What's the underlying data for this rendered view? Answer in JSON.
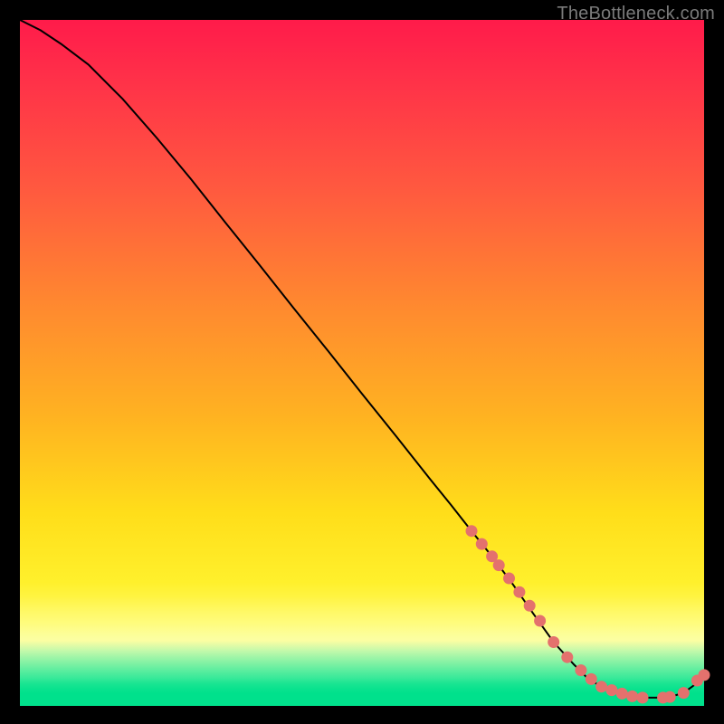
{
  "watermark": "TheBottleneck.com",
  "colors": {
    "dot": "#e4716d",
    "line": "#000000",
    "bg": "#000000"
  },
  "chart_data": {
    "type": "line",
    "title": "",
    "xlabel": "",
    "ylabel": "",
    "xlim": [
      0,
      100
    ],
    "ylim": [
      0,
      100
    ],
    "grid": false,
    "legend": false,
    "series": [
      {
        "name": "curve",
        "x": [
          0,
          3,
          6,
          10,
          15,
          20,
          25,
          30,
          35,
          40,
          45,
          50,
          55,
          60,
          63,
          66,
          69,
          72,
          75,
          78,
          81,
          83,
          85,
          87,
          89,
          91,
          93,
          95,
          97,
          98.5,
          100
        ],
        "y": [
          100,
          98.5,
          96.5,
          93.5,
          88.5,
          82.8,
          76.8,
          70.5,
          64.3,
          58.0,
          51.8,
          45.5,
          39.3,
          33.0,
          29.3,
          25.5,
          21.8,
          17.8,
          13.5,
          9.3,
          6.0,
          4.0,
          2.8,
          2.0,
          1.5,
          1.2,
          1.2,
          1.3,
          1.9,
          3.0,
          4.5
        ]
      }
    ],
    "dots": {
      "name": "highlighted-points",
      "x": [
        66,
        67.5,
        69,
        70,
        71.5,
        73,
        74.5,
        76,
        78,
        80,
        82,
        83.5,
        85,
        86.5,
        88,
        89.5,
        91,
        94,
        95,
        97,
        99,
        100
      ],
      "y": [
        25.5,
        23.6,
        21.8,
        20.5,
        18.6,
        16.6,
        14.6,
        12.4,
        9.3,
        7.1,
        5.2,
        3.9,
        2.8,
        2.3,
        1.8,
        1.4,
        1.2,
        1.2,
        1.3,
        1.9,
        3.7,
        4.5
      ]
    }
  }
}
